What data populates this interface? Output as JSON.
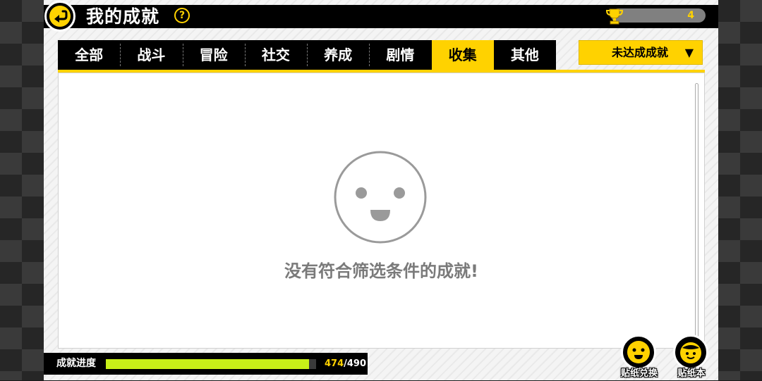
{
  "header": {
    "title": "我的成就",
    "help_label": "?",
    "trophy_count": "4"
  },
  "tabs": [
    {
      "label": "全部",
      "active": false
    },
    {
      "label": "战斗",
      "active": false
    },
    {
      "label": "冒险",
      "active": false
    },
    {
      "label": "社交",
      "active": false
    },
    {
      "label": "养成",
      "active": false
    },
    {
      "label": "剧情",
      "active": false
    },
    {
      "label": "收集",
      "active": true
    },
    {
      "label": "其他",
      "active": false
    }
  ],
  "filter": {
    "selected": "未达成成就",
    "arrow": "▼"
  },
  "content": {
    "empty_message": "没有符合筛选条件的成就!",
    "empty_icon": "smiley-face-icon"
  },
  "progress": {
    "label": "成就进度",
    "current": "474",
    "separator": "/",
    "total": "490",
    "fraction": 0.967
  },
  "buttons": {
    "sticker_exchange": "贴纸兑换",
    "sticker_book": "贴纸本"
  },
  "colors": {
    "accent": "#ffd200",
    "progress_fill": "#c8f018"
  }
}
